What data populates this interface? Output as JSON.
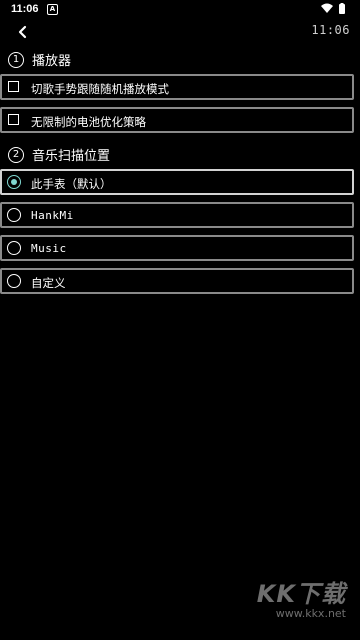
{
  "status_bar": {
    "time": "11:06",
    "notification_icon": "A"
  },
  "header": {
    "back_icon": "chevron-left",
    "clock": "11:06"
  },
  "sections": [
    {
      "number": "①",
      "title": "播放器"
    },
    {
      "number": "②",
      "title": "音乐扫描位置"
    }
  ],
  "player_options": [
    {
      "label": "切歌手势跟随随机播放模式",
      "checked": false
    },
    {
      "label": "无限制的电池优化策略",
      "checked": false
    }
  ],
  "scan_locations": [
    {
      "label": "此手表（默认）",
      "selected": true
    },
    {
      "label": "HankMi",
      "selected": false
    },
    {
      "label": "Music",
      "selected": false
    },
    {
      "label": "自定义",
      "selected": false
    }
  ],
  "watermark": {
    "logo": "KK下载",
    "url": "www.kkx.net"
  },
  "colors": {
    "background": "#000000",
    "border": "#8a8a8a",
    "accent": "#7fd6cf"
  }
}
